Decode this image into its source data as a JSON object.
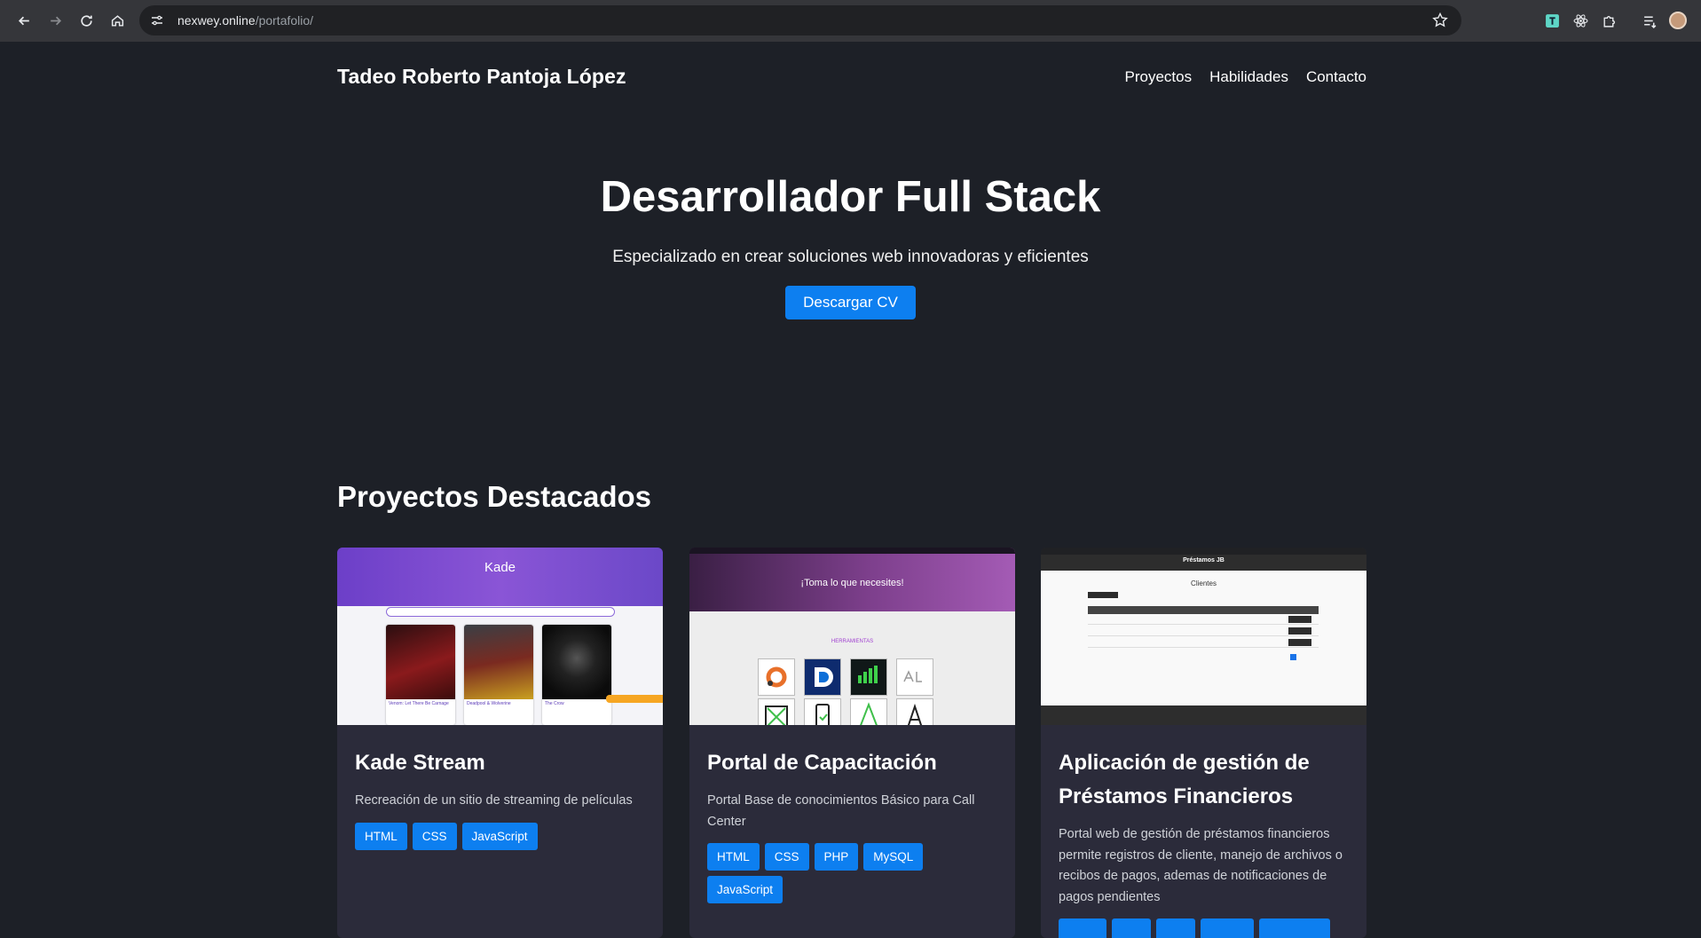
{
  "browser": {
    "url_host": "nexwey.online",
    "url_path": "/portafolio/"
  },
  "header": {
    "brand": "Tadeo Roberto Pantoja López",
    "nav": [
      "Proyectos",
      "Habilidades",
      "Contacto"
    ]
  },
  "hero": {
    "title": "Desarrollador Full Stack",
    "subtitle": "Especializado en crear soluciones web innovadoras y eficientes",
    "cta": "Descargar CV"
  },
  "projects": {
    "title": "Proyectos Destacados",
    "items": [
      {
        "title": "Kade Stream",
        "description": "Recreación de un sitio de streaming de películas",
        "tags": [
          "HTML",
          "CSS",
          "JavaScript"
        ],
        "thumb": {
          "site_title": "Kade",
          "posters": [
            "Venom: Let There Be Carnage",
            "Deadpool & Wolverine",
            "The Crow"
          ]
        }
      },
      {
        "title": "Portal de Capacitación",
        "description": "Portal Base de conocimientos Básico para Call Center",
        "tags": [
          "HTML",
          "CSS",
          "PHP",
          "MySQL",
          "JavaScript"
        ],
        "thumb": {
          "heading": "¡Toma lo que necesites!",
          "section": "HERRAMIENTAS"
        }
      },
      {
        "title": "Aplicación de gestión de Préstamos Financieros",
        "description": "Portal web de gestión de préstamos financieros permite registros de cliente, manejo de archivos o recibos de pagos, ademas de notificaciones de pagos pendientes",
        "tags": [
          "",
          "",
          "",
          "",
          ""
        ],
        "thumb": {
          "site_title": "Préstamos JB",
          "page_title": "Clientes"
        }
      }
    ]
  },
  "colors": {
    "page_bg": "#1d2027",
    "card_bg": "#2b2b3a",
    "accent": "#0d7ff0"
  }
}
